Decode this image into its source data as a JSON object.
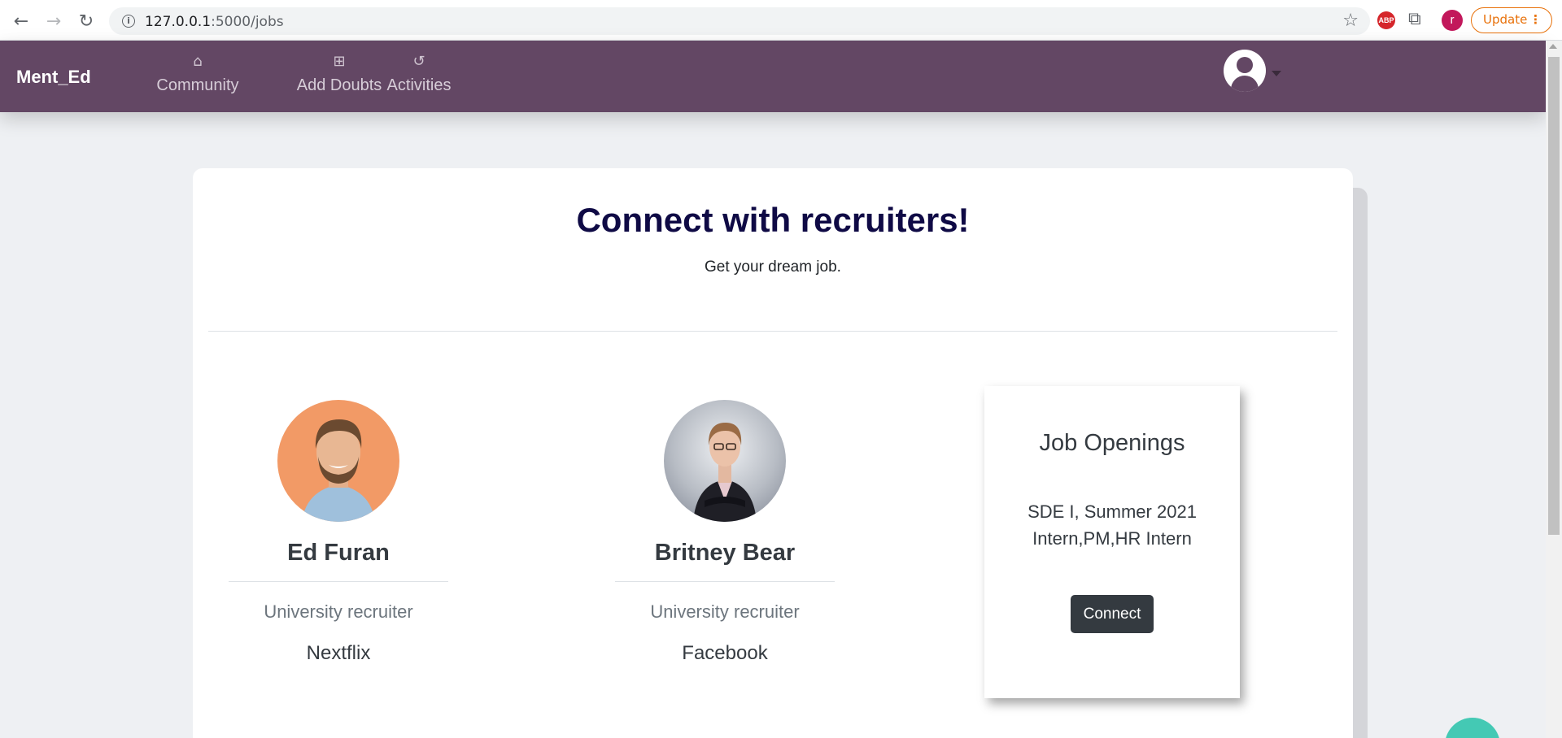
{
  "browser": {
    "url_host": "127.0.0.1",
    "url_path": ":5000/jobs",
    "profile_initial": "r",
    "abp_label": "ABP",
    "update_label": "Update",
    "icons": [
      "back-arrow-icon",
      "forward-arrow-icon",
      "reload-icon",
      "info-icon",
      "star-icon",
      "puzzle-icon",
      "kebab-menu-icon"
    ]
  },
  "navbar": {
    "brand": "Ment_Ed",
    "items": [
      {
        "label": "Community",
        "icon": "home-icon"
      },
      {
        "label": "Add Doubts",
        "icon": "plus-square-icon"
      },
      {
        "label": "Activities",
        "icon": "history-icon"
      }
    ],
    "background_color": "#634764"
  },
  "main": {
    "title": "Connect with recruiters!",
    "subtitle": "Get your dream job."
  },
  "recruiters": [
    {
      "name": "Ed Furan",
      "role": "University recruiter",
      "company": "Nextflix"
    },
    {
      "name": "Britney Bear",
      "role": "University recruiter",
      "company": "Facebook"
    }
  ],
  "jobs": {
    "title": "Job Openings",
    "openings": [
      "SDE I, Summer 2021",
      "Intern,PM,HR Intern"
    ],
    "connect_label": "Connect"
  },
  "colors": {
    "title": "#0f0a45",
    "accent_update": "#e8710a",
    "button_dark": "#343a40",
    "chat": "#44c9b4"
  }
}
